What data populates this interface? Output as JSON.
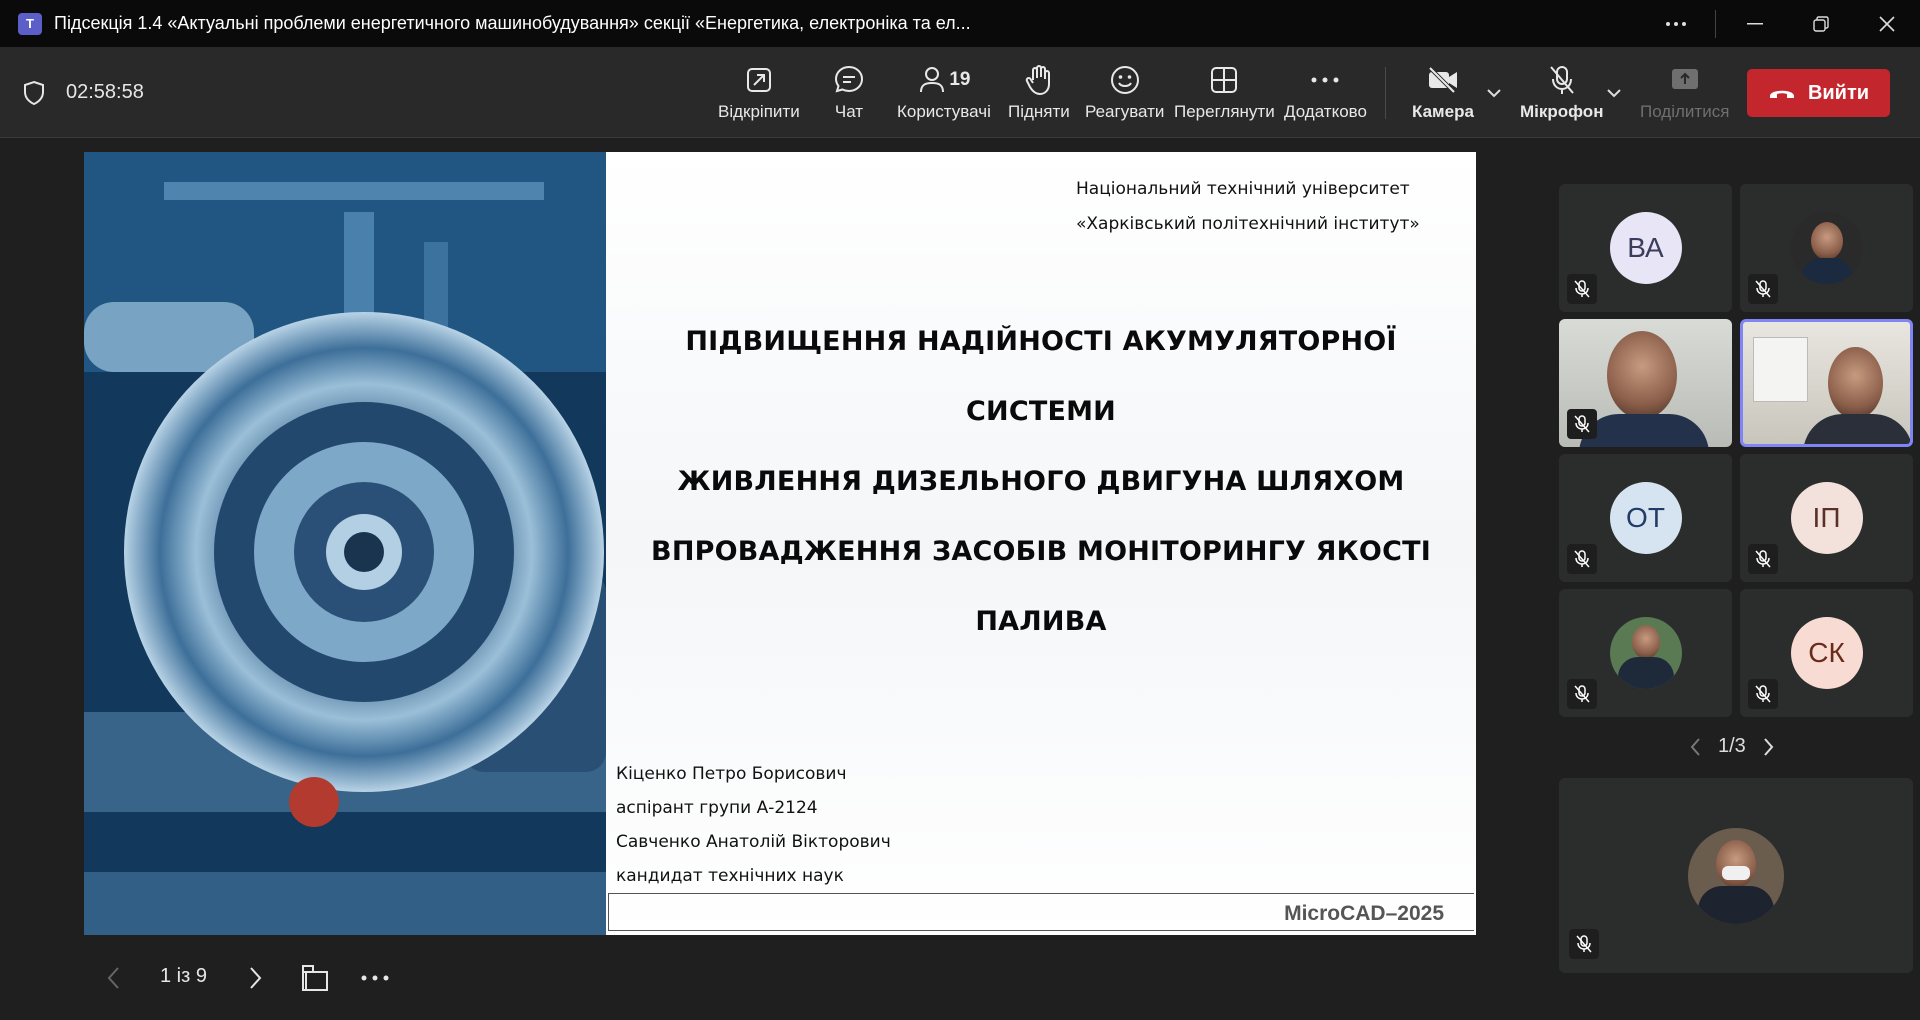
{
  "window": {
    "app_icon": "teams-icon",
    "title": "Підсекція 1.4 «Актуальні проблеми енергетичного машинобудування» секції «Енергетика, електроніка та ел..."
  },
  "toolbar": {
    "timer": "02:58:58",
    "buttons": [
      {
        "label": "Відкріпити",
        "icon": "unpin-icon"
      },
      {
        "label": "Чат",
        "icon": "chat-icon"
      },
      {
        "label": "Користувачі",
        "icon": "people-icon",
        "count": "19"
      },
      {
        "label": "Підняти",
        "icon": "raise-hand-icon"
      },
      {
        "label": "Реагувати",
        "icon": "react-icon"
      },
      {
        "label": "Переглянути",
        "icon": "view-icon"
      },
      {
        "label": "Додатково",
        "icon": "more-icon"
      },
      {
        "label": "Камера",
        "icon": "camera-off-icon"
      },
      {
        "label": "Мікрофон",
        "icon": "mic-off-icon"
      },
      {
        "label": "Поділитися",
        "icon": "share-icon"
      }
    ],
    "leave_label": "Вийти"
  },
  "slide": {
    "university_line1": "Національний технічний університет",
    "university_line2": "«Харківський політехнічний інститут»",
    "title_line1": "ПІДВИЩЕННЯ НАДІЙНОСТІ АКУМУЛЯТОРНОЇ СИСТЕМИ",
    "title_line2": "ЖИВЛЕННЯ ДИЗЕЛЬНОГО ДВИГУНА ШЛЯХОМ",
    "title_line3": "ВПРОВАДЖЕННЯ ЗАСОБІВ МОНІТОРИНГУ ЯКОСТІ ПАЛИВА",
    "authors": [
      "Кіценко Петро Борисович",
      "аспірант групи А-2124",
      "Савченко Анатолій Вікторович",
      "кандидат технічних наук"
    ],
    "footer": "MicroCAD–2025"
  },
  "slide_nav": {
    "page": "1 із 9"
  },
  "participants": {
    "tiles": [
      {
        "initials": "ВА",
        "type": "avatar",
        "bg": "#e8e6f6",
        "fg": "#3a3d5c"
      },
      {
        "initials": "",
        "type": "photo"
      },
      {
        "initials": "",
        "type": "video"
      },
      {
        "initials": "",
        "type": "video",
        "active": true
      },
      {
        "initials": "ОТ",
        "type": "avatar",
        "bg": "#d6e4f2",
        "fg": "#1f3d66"
      },
      {
        "initials": "ІП",
        "type": "avatar",
        "bg": "#f3e2dc",
        "fg": "#5a3028"
      },
      {
        "initials": "",
        "type": "photo"
      },
      {
        "initials": "СК",
        "type": "avatar",
        "bg": "#f8dcd3",
        "fg": "#6b2b1b"
      }
    ],
    "pager": "1/3"
  },
  "colors": {
    "leave": "#c4262e",
    "active_border": "#7f85f5",
    "background": "#1f1f1f"
  }
}
